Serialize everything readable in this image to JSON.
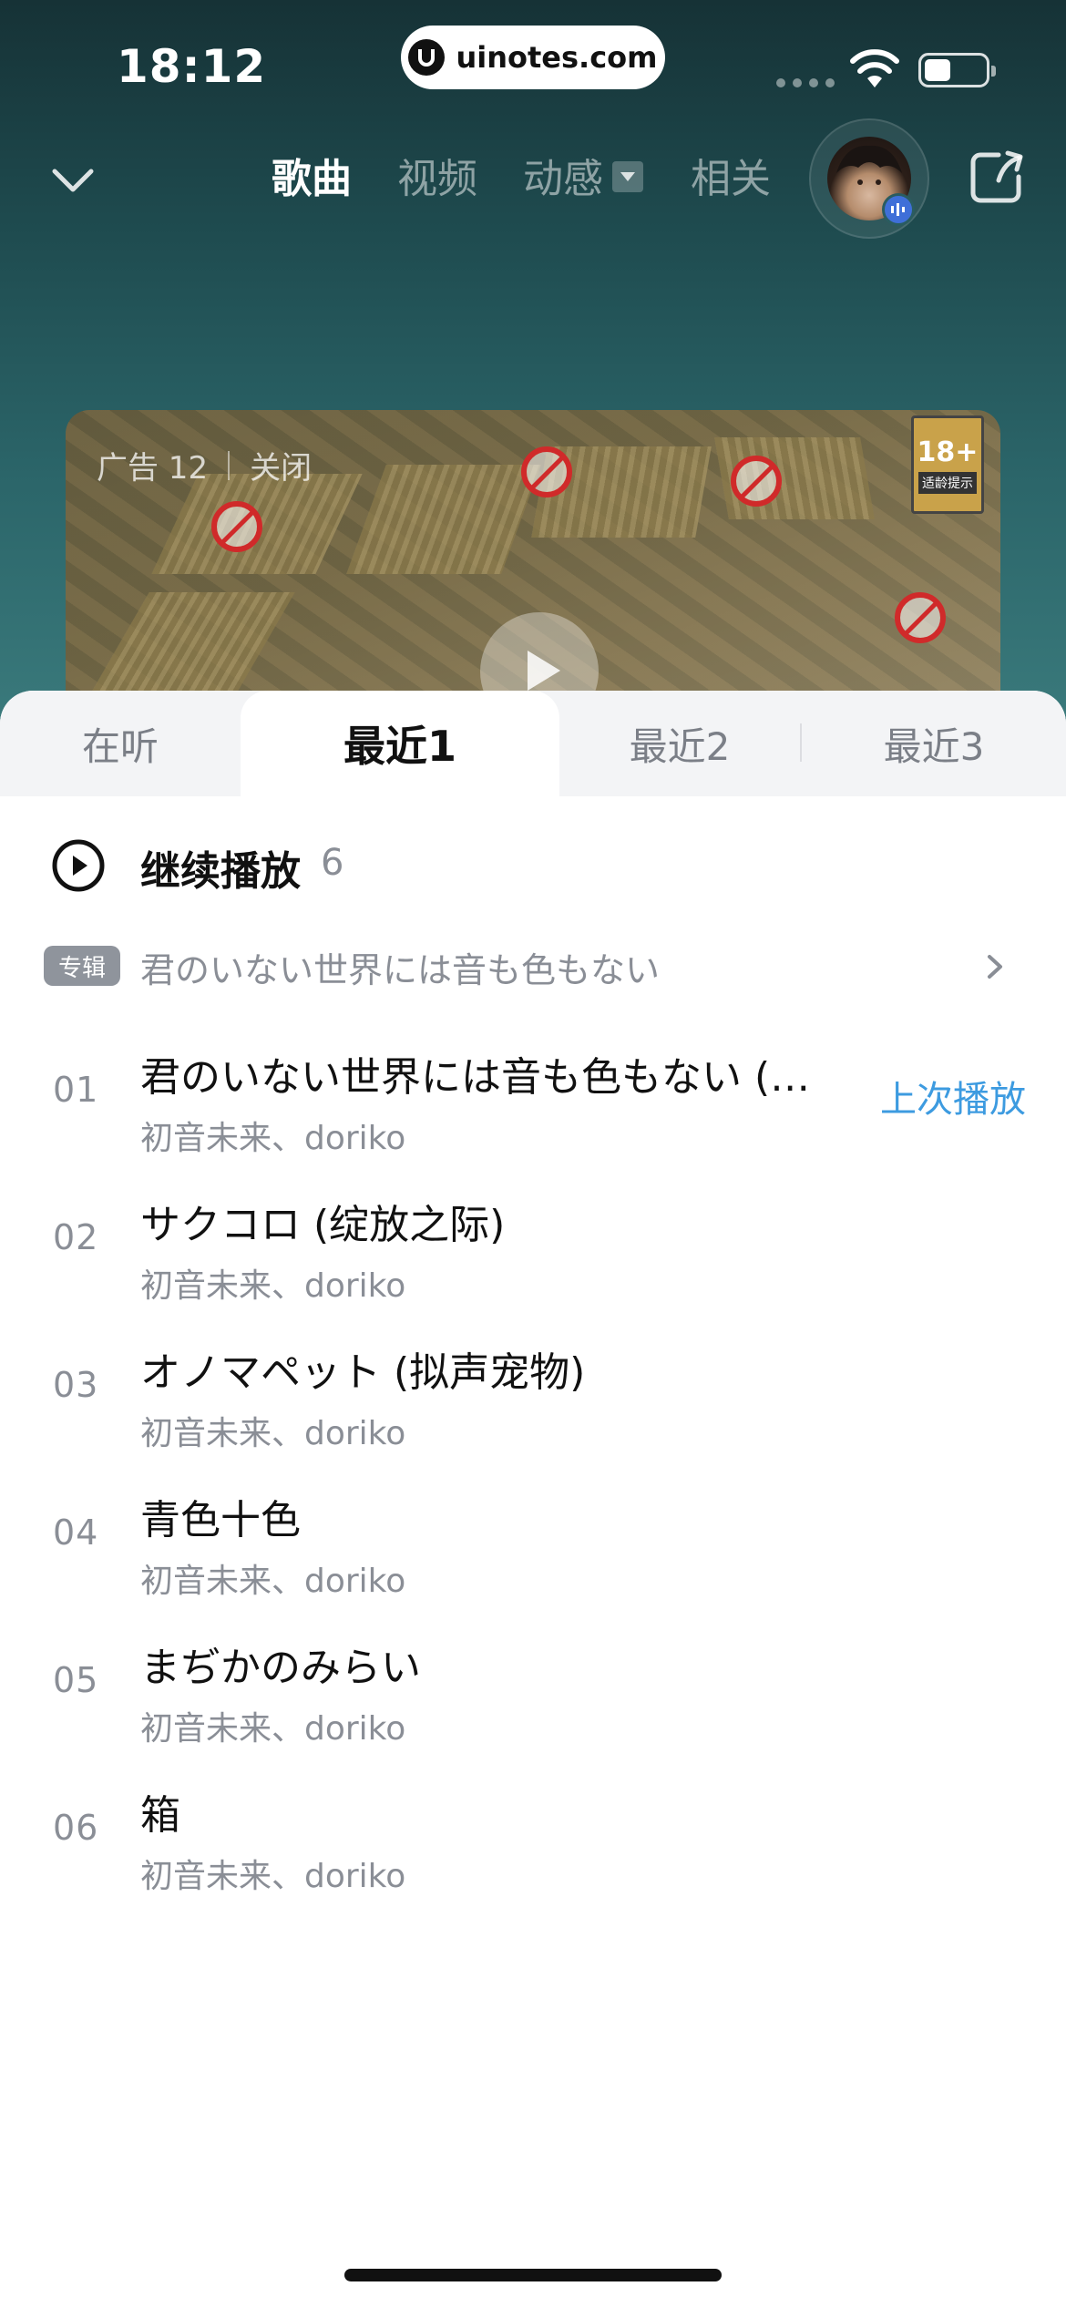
{
  "status_bar": {
    "time": "18:12",
    "url": "uinotes.com"
  },
  "top_nav": {
    "tabs": [
      "歌曲",
      "视频",
      "动感",
      "相关"
    ],
    "active_tab": "歌曲"
  },
  "ad": {
    "label": "广告 12",
    "close": "关闭",
    "age_rating": "18+",
    "age_note": "适龄提示"
  },
  "sheet": {
    "tabs": [
      "在听",
      "最近1",
      "最近2",
      "最近3"
    ],
    "active_tab": "最近1",
    "continue_label": "继续播放",
    "continue_count": "6",
    "album_tag": "专辑",
    "album_name": "君のいない世界には音も色もない",
    "last_played_label": "上次播放",
    "songs": [
      {
        "num": "01",
        "title": "君のいない世界には音も色もない (…",
        "artist": "初音未来、doriko"
      },
      {
        "num": "02",
        "title": "サクコロ (绽放之际)",
        "artist": "初音未来、doriko"
      },
      {
        "num": "03",
        "title": "オノマペット (拟声宠物)",
        "artist": "初音未来、doriko"
      },
      {
        "num": "04",
        "title": "青色十色",
        "artist": "初音未来、doriko"
      },
      {
        "num": "05",
        "title": "まぢかのみらい",
        "artist": "初音未来、doriko"
      },
      {
        "num": "06",
        "title": "箱",
        "artist": "初音未来、doriko"
      }
    ]
  },
  "colors": {
    "accent_blue": "#3d9be0",
    "header_bg": "#1e4a4e"
  }
}
